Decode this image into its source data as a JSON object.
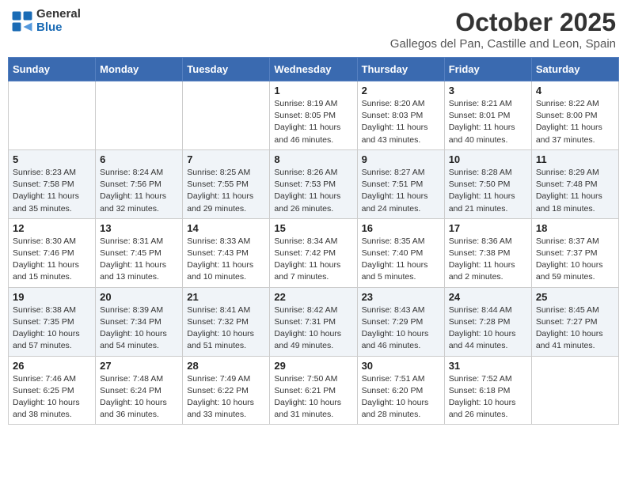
{
  "header": {
    "logo_general": "General",
    "logo_blue": "Blue",
    "month_title": "October 2025",
    "subtitle": "Gallegos del Pan, Castille and Leon, Spain"
  },
  "days_of_week": [
    "Sunday",
    "Monday",
    "Tuesday",
    "Wednesday",
    "Thursday",
    "Friday",
    "Saturday"
  ],
  "weeks": [
    [
      {
        "day": "",
        "info": ""
      },
      {
        "day": "",
        "info": ""
      },
      {
        "day": "",
        "info": ""
      },
      {
        "day": "1",
        "info": "Sunrise: 8:19 AM\nSunset: 8:05 PM\nDaylight: 11 hours and 46 minutes."
      },
      {
        "day": "2",
        "info": "Sunrise: 8:20 AM\nSunset: 8:03 PM\nDaylight: 11 hours and 43 minutes."
      },
      {
        "day": "3",
        "info": "Sunrise: 8:21 AM\nSunset: 8:01 PM\nDaylight: 11 hours and 40 minutes."
      },
      {
        "day": "4",
        "info": "Sunrise: 8:22 AM\nSunset: 8:00 PM\nDaylight: 11 hours and 37 minutes."
      }
    ],
    [
      {
        "day": "5",
        "info": "Sunrise: 8:23 AM\nSunset: 7:58 PM\nDaylight: 11 hours and 35 minutes."
      },
      {
        "day": "6",
        "info": "Sunrise: 8:24 AM\nSunset: 7:56 PM\nDaylight: 11 hours and 32 minutes."
      },
      {
        "day": "7",
        "info": "Sunrise: 8:25 AM\nSunset: 7:55 PM\nDaylight: 11 hours and 29 minutes."
      },
      {
        "day": "8",
        "info": "Sunrise: 8:26 AM\nSunset: 7:53 PM\nDaylight: 11 hours and 26 minutes."
      },
      {
        "day": "9",
        "info": "Sunrise: 8:27 AM\nSunset: 7:51 PM\nDaylight: 11 hours and 24 minutes."
      },
      {
        "day": "10",
        "info": "Sunrise: 8:28 AM\nSunset: 7:50 PM\nDaylight: 11 hours and 21 minutes."
      },
      {
        "day": "11",
        "info": "Sunrise: 8:29 AM\nSunset: 7:48 PM\nDaylight: 11 hours and 18 minutes."
      }
    ],
    [
      {
        "day": "12",
        "info": "Sunrise: 8:30 AM\nSunset: 7:46 PM\nDaylight: 11 hours and 15 minutes."
      },
      {
        "day": "13",
        "info": "Sunrise: 8:31 AM\nSunset: 7:45 PM\nDaylight: 11 hours and 13 minutes."
      },
      {
        "day": "14",
        "info": "Sunrise: 8:33 AM\nSunset: 7:43 PM\nDaylight: 11 hours and 10 minutes."
      },
      {
        "day": "15",
        "info": "Sunrise: 8:34 AM\nSunset: 7:42 PM\nDaylight: 11 hours and 7 minutes."
      },
      {
        "day": "16",
        "info": "Sunrise: 8:35 AM\nSunset: 7:40 PM\nDaylight: 11 hours and 5 minutes."
      },
      {
        "day": "17",
        "info": "Sunrise: 8:36 AM\nSunset: 7:38 PM\nDaylight: 11 hours and 2 minutes."
      },
      {
        "day": "18",
        "info": "Sunrise: 8:37 AM\nSunset: 7:37 PM\nDaylight: 10 hours and 59 minutes."
      }
    ],
    [
      {
        "day": "19",
        "info": "Sunrise: 8:38 AM\nSunset: 7:35 PM\nDaylight: 10 hours and 57 minutes."
      },
      {
        "day": "20",
        "info": "Sunrise: 8:39 AM\nSunset: 7:34 PM\nDaylight: 10 hours and 54 minutes."
      },
      {
        "day": "21",
        "info": "Sunrise: 8:41 AM\nSunset: 7:32 PM\nDaylight: 10 hours and 51 minutes."
      },
      {
        "day": "22",
        "info": "Sunrise: 8:42 AM\nSunset: 7:31 PM\nDaylight: 10 hours and 49 minutes."
      },
      {
        "day": "23",
        "info": "Sunrise: 8:43 AM\nSunset: 7:29 PM\nDaylight: 10 hours and 46 minutes."
      },
      {
        "day": "24",
        "info": "Sunrise: 8:44 AM\nSunset: 7:28 PM\nDaylight: 10 hours and 44 minutes."
      },
      {
        "day": "25",
        "info": "Sunrise: 8:45 AM\nSunset: 7:27 PM\nDaylight: 10 hours and 41 minutes."
      }
    ],
    [
      {
        "day": "26",
        "info": "Sunrise: 7:46 AM\nSunset: 6:25 PM\nDaylight: 10 hours and 38 minutes."
      },
      {
        "day": "27",
        "info": "Sunrise: 7:48 AM\nSunset: 6:24 PM\nDaylight: 10 hours and 36 minutes."
      },
      {
        "day": "28",
        "info": "Sunrise: 7:49 AM\nSunset: 6:22 PM\nDaylight: 10 hours and 33 minutes."
      },
      {
        "day": "29",
        "info": "Sunrise: 7:50 AM\nSunset: 6:21 PM\nDaylight: 10 hours and 31 minutes."
      },
      {
        "day": "30",
        "info": "Sunrise: 7:51 AM\nSunset: 6:20 PM\nDaylight: 10 hours and 28 minutes."
      },
      {
        "day": "31",
        "info": "Sunrise: 7:52 AM\nSunset: 6:18 PM\nDaylight: 10 hours and 26 minutes."
      },
      {
        "day": "",
        "info": ""
      }
    ]
  ]
}
